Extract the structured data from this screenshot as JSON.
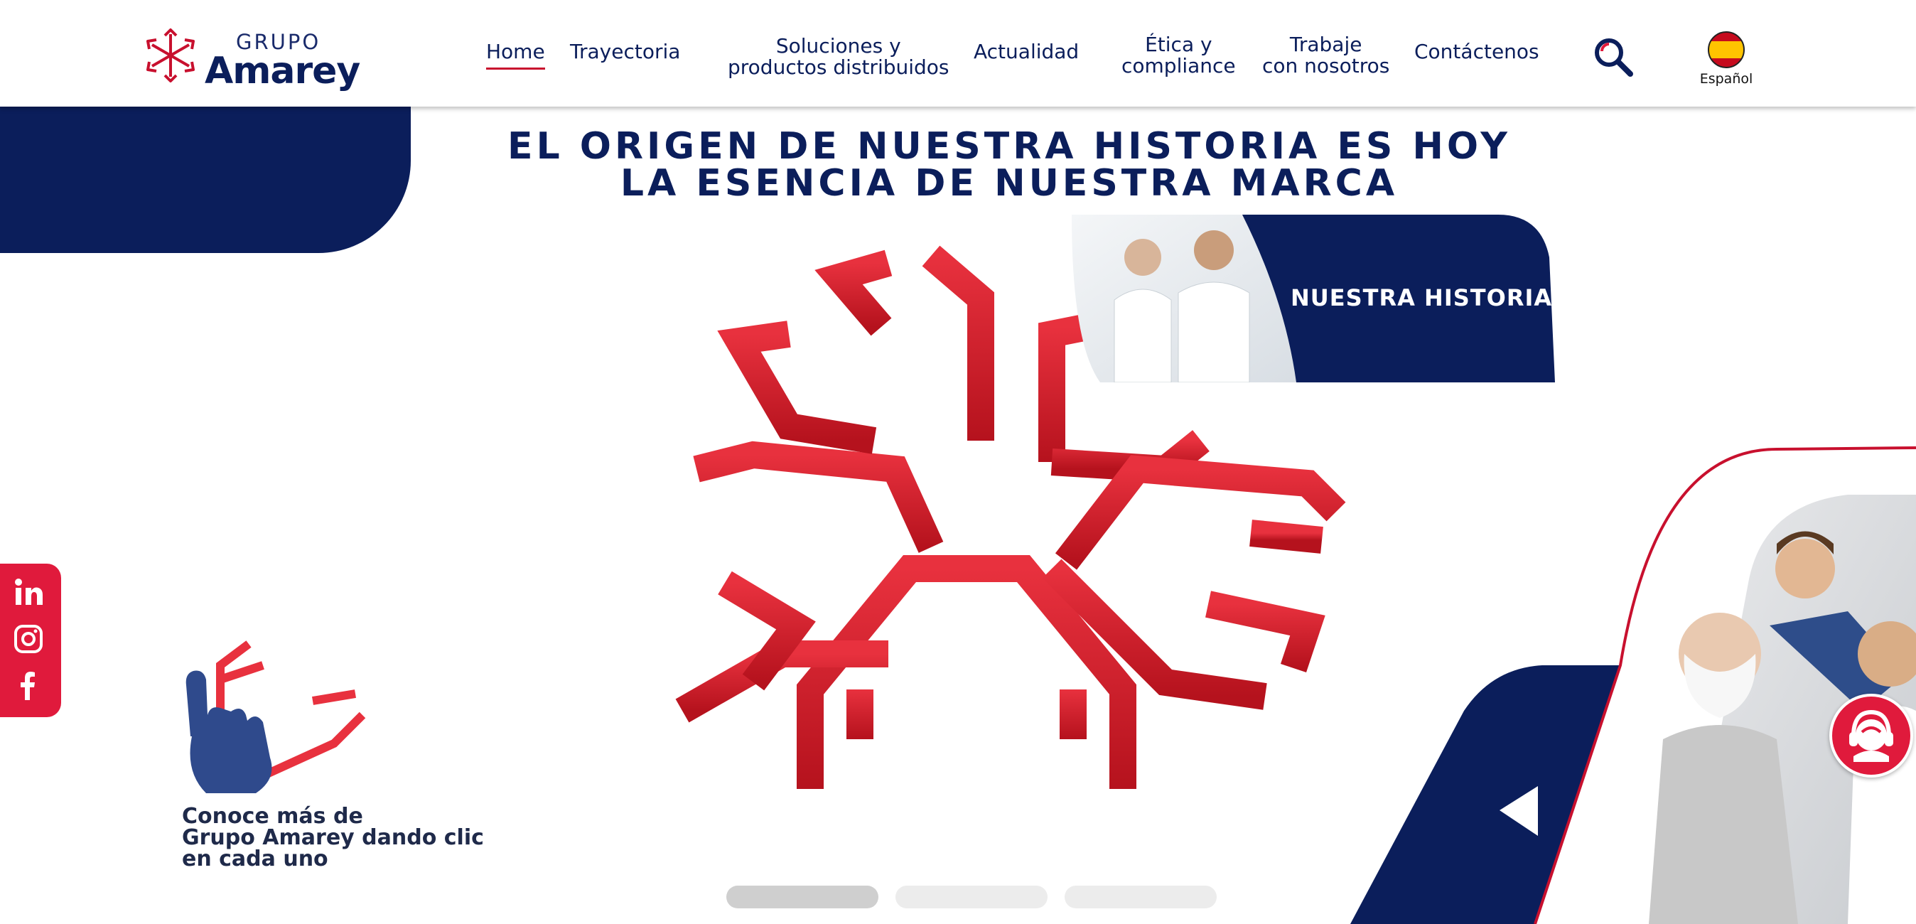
{
  "header": {
    "logo": {
      "small": "GRUPO",
      "big": "Amarey"
    },
    "nav": [
      {
        "label": "Home",
        "active": true
      },
      {
        "label": "Trayectoria"
      },
      {
        "label_line1": "Soluciones y",
        "label_line2": "productos distribuidos"
      },
      {
        "label": "Actualidad"
      },
      {
        "label_line1": "Ética y",
        "label_line2": "compliance"
      },
      {
        "label_line1": "Trabaje",
        "label_line2": "con nosotros"
      },
      {
        "label": "Contáctenos"
      }
    ],
    "search_icon": "search-icon",
    "language": {
      "label": "Español",
      "flag": "spain-flag"
    }
  },
  "hero": {
    "title_line1": "EL ORIGEN DE NUESTRA HISTORIA ES HOY",
    "title_line2": "LA ESENCIA DE NUESTRA MARCA",
    "historia_button": "NUESTRA HISTORIA"
  },
  "social": [
    "linkedin-icon",
    "instagram-icon",
    "facebook-icon"
  ],
  "hint": {
    "line1": "Conoce más de",
    "line2": "Grupo Amarey dando clic",
    "line3": "en cada uno"
  },
  "carousel": {
    "slides": 3,
    "active": 0
  },
  "colors": {
    "brand_blue": "#0b1e5b",
    "brand_red": "#c8102e",
    "accent_red": "#e01a3c"
  }
}
